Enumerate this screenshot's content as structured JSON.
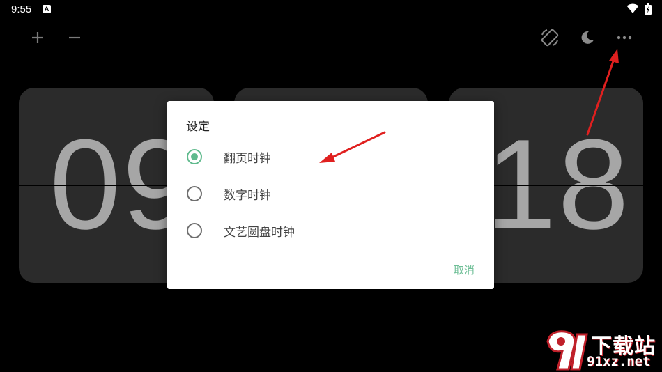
{
  "status_bar": {
    "time": "9:55",
    "notification_icon": "a-icon",
    "wifi_icon": "wifi-icon",
    "battery_icon": "battery-icon"
  },
  "toolbar": {
    "left": [
      {
        "icon": "plus-icon"
      },
      {
        "icon": "minus-icon"
      }
    ],
    "right": [
      {
        "icon": "screen-rotation-icon"
      },
      {
        "icon": "moon-icon"
      },
      {
        "icon": "more-horizontal-icon"
      }
    ]
  },
  "clock": {
    "hours": "09",
    "minutes": "",
    "seconds": "18",
    "digit_color": "#a6a6a6",
    "card_color": "#2b2b2b"
  },
  "dialog": {
    "title": "设定",
    "options": [
      {
        "label": "翻页时钟",
        "selected": true
      },
      {
        "label": "数字时钟",
        "selected": false
      },
      {
        "label": "文艺圆盘时钟",
        "selected": false
      }
    ],
    "cancel_label": "取消",
    "accent_color": "#5fba8d"
  },
  "annotations": {
    "arrow_color": "#e0201f"
  },
  "watermark": {
    "logo_text": "下载站",
    "domain": "91xz.net"
  }
}
